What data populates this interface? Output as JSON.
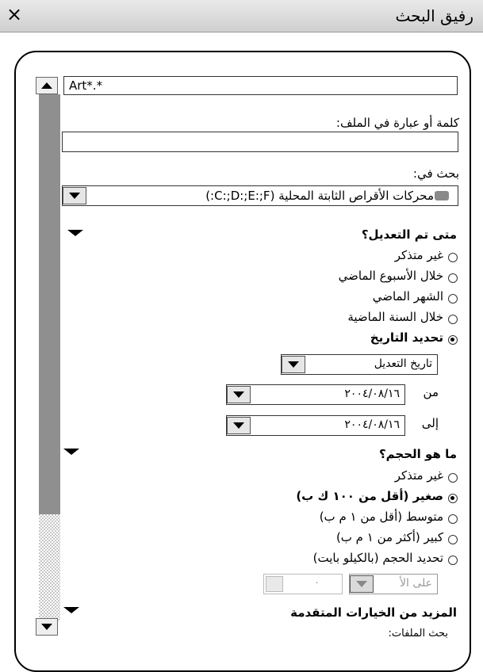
{
  "window": {
    "title": "رفيق البحث",
    "close": "×"
  },
  "search": {
    "filename_value": "Art*.*",
    "keyword_label": "كلمة أو عبارة في الملف:",
    "keyword_value": "",
    "look_in_label": "بحث في:",
    "look_in_value": "محركات الأقراص الثابتة المحلية (C:;D:;E:;F:)"
  },
  "modified": {
    "heading": "متى تم التعديل؟",
    "options": [
      "غير متذكر",
      "خلال الأسبوع الماضي",
      "الشهر الماضي",
      "خلال السنة الماضية",
      "تحديد التاريخ"
    ],
    "selected": "تحديد التاريخ",
    "date_type": "تاريخ التعديل",
    "from_label": "من",
    "from_value": "٢٠٠٤/٠٨/١٦",
    "to_label": "إلى",
    "to_value": "٢٠٠٤/٠٨/١٦"
  },
  "size": {
    "heading": "ما هو الحجم؟",
    "options": [
      "غير متذكر",
      "صغير (أقل من ١٠٠ ك ب)",
      "متوسط (أقل من ١ م ب)",
      "كبير (أكثر من ١ م ب)",
      "تحديد الحجم (بالكيلو بايت)"
    ],
    "selected": "صغير (أقل من ١٠٠ ك ب)",
    "qualifier": "على الأ",
    "amount": "٠"
  },
  "advanced": {
    "heading": "المزيد من الخيارات المتقدمة",
    "partial": "بحث الملفات:"
  },
  "colors": {
    "titlebar": "#d8d8d8",
    "thumb": "#8f8f8f"
  }
}
